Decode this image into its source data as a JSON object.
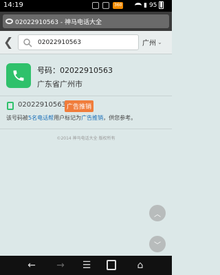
{
  "status_bar": {
    "time": "14:19",
    "app_badge": "360",
    "battery": "95"
  },
  "url_bar": {
    "text": "02022910563 - 神马电话大全"
  },
  "header": {
    "search_value": "02022910563",
    "city": "广州"
  },
  "result": {
    "number_line": "号码：02022910563",
    "location": "广东省广州市"
  },
  "mark": {
    "number": "02022910563",
    "badge": "广告推销",
    "desc_prefix": "该号码被",
    "desc_count": "5名电话帮",
    "desc_middle": "用户标记为",
    "desc_tag": "广告推销",
    "desc_suffix": "，供您参考。"
  },
  "footer": {
    "copyright": "©2014 神马电话大全 版权所有"
  },
  "colors": {
    "accent_green": "#2fc16b",
    "badge_orange": "#f07d3c",
    "link_blue": "#1a6fb8"
  },
  "icons": {
    "back": "chevron-left-icon",
    "search": "search-icon",
    "phone": "phone-icon",
    "mobile": "mobile-icon",
    "scroll_up": "chevron-up-icon",
    "scroll_down": "chevron-down-icon"
  }
}
